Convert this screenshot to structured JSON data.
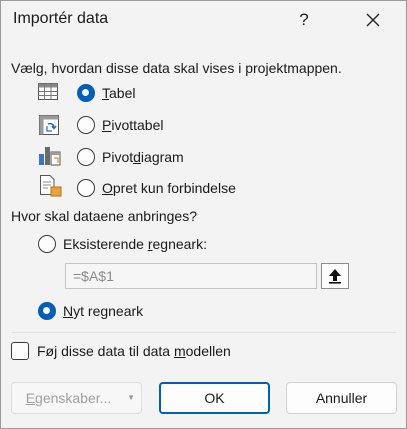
{
  "window": {
    "title": "Importér data",
    "help_glyph": "?"
  },
  "display_group": {
    "prompt": "Vælg, hvordan disse data skal vises i projektmappen.",
    "options": [
      {
        "key": "T",
        "rest": "abel",
        "icon": "table-icon",
        "selected": true
      },
      {
        "key": "P",
        "rest": "ivottabel",
        "icon": "pivottable-icon",
        "selected": false
      },
      {
        "pre": "Pivot",
        "key": "d",
        "rest": "iagram",
        "icon": "pivotchart-icon",
        "selected": false
      },
      {
        "key": "O",
        "rest": "pret kun forbindelse",
        "icon": "connection-icon",
        "selected": false
      }
    ]
  },
  "location_group": {
    "prompt": "Hvor skal dataene anbringes?",
    "existing": {
      "pre": "Eksisterende ",
      "key": "r",
      "rest": "egneark:",
      "selected": false
    },
    "reference_value": "=$A$1",
    "new_sheet": {
      "key": "N",
      "rest": "yt regneark",
      "selected": true
    }
  },
  "data_model": {
    "pre": "Føj disse data til data ",
    "key": "m",
    "rest": "odellen",
    "checked": false
  },
  "buttons": {
    "properties": {
      "key": "E",
      "rest": "genskaber...",
      "disabled": true
    },
    "ok": "OK",
    "cancel": "Annuller"
  },
  "colors": {
    "accent": "#005fb8",
    "background": "#f3f3f3"
  }
}
